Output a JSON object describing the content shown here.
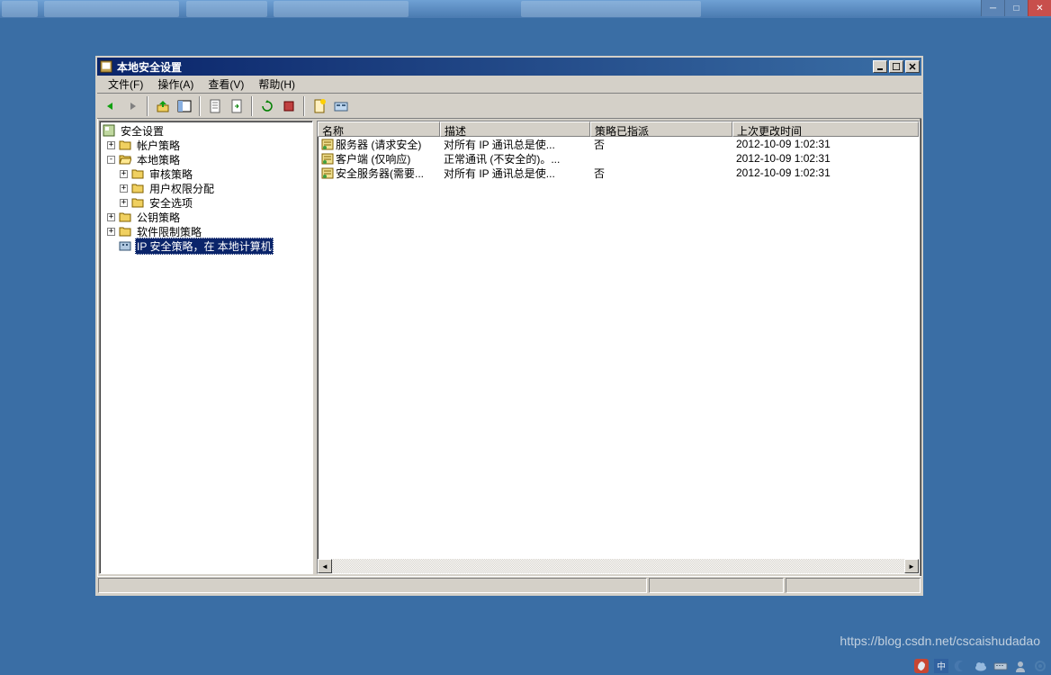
{
  "window": {
    "title": "本地安全设置",
    "controls": {
      "min": "_",
      "max": "□",
      "close": "×"
    }
  },
  "menubar": {
    "file": "文件(F)",
    "action": "操作(A)",
    "view": "查看(V)",
    "help": "帮助(H)"
  },
  "tree": {
    "root": "安全设置",
    "account_policy": "帐户策略",
    "local_policy": "本地策略",
    "audit_policy": "审核策略",
    "user_rights": "用户权限分配",
    "security_options": "安全选项",
    "public_key": "公钥策略",
    "software_restriction": "软件限制策略",
    "ip_security": "IP 安全策略，在 本地计算机"
  },
  "list": {
    "columns": {
      "name": "名称",
      "description": "描述",
      "assigned": "策略已指派",
      "modified": "上次更改时间"
    },
    "rows": [
      {
        "name": "服务器 (请求安全)",
        "desc": "对所有 IP 通讯总是使...",
        "assigned": "否",
        "modified": "2012-10-09 1:02:31"
      },
      {
        "name": "客户端 (仅响应)",
        "desc": "正常通讯 (不安全的)。...",
        "assigned": "",
        "modified": "2012-10-09 1:02:31"
      },
      {
        "name": "安全服务器(需要...",
        "desc": "对所有 IP 通讯总是使...",
        "assigned": "否",
        "modified": "2012-10-09 1:02:31"
      }
    ]
  },
  "watermark": "https://blog.csdn.net/cscaishudadao"
}
